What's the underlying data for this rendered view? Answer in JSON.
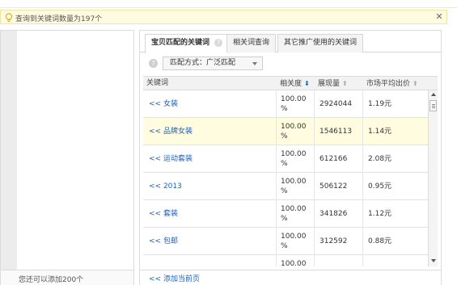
{
  "notice": {
    "message": "查询到关键词数量为197个",
    "close": "✕"
  },
  "left_panel": {
    "remaining_text": "您还可以添加200个"
  },
  "tabs": [
    {
      "label": "宝贝匹配的关键词",
      "active": true,
      "help": "?"
    },
    {
      "label": "相关词查询",
      "active": false
    },
    {
      "label": "其它推广使用的关键词",
      "active": false
    }
  ],
  "match": {
    "help": "?",
    "select_value": "匹配方式：广泛匹配"
  },
  "table": {
    "columns": [
      {
        "label": "关键词",
        "sort": ""
      },
      {
        "label": "相关度",
        "sort": "⬇"
      },
      {
        "label": "展现量",
        "sort": "⬆"
      },
      {
        "label": "市场平均出价",
        "sort": "⬆"
      }
    ],
    "rows": [
      {
        "keyword": "<< 女装",
        "relevance": "100.00 %",
        "impressions": "2924044",
        "price": "1.19元",
        "highlight": false
      },
      {
        "keyword": "<< 品牌女装",
        "relevance": "100.00 %",
        "impressions": "1546113",
        "price": "1.14元",
        "highlight": true
      },
      {
        "keyword": "<< 运动套装",
        "relevance": "100.00 %",
        "impressions": "612166",
        "price": "2.08元",
        "highlight": false
      },
      {
        "keyword": "<< 2013",
        "relevance": "100.00 %",
        "impressions": "506122",
        "price": "0.95元",
        "highlight": false
      },
      {
        "keyword": "<< 套装",
        "relevance": "100.00 %",
        "impressions": "341826",
        "price": "1.12元",
        "highlight": false
      },
      {
        "keyword": "<< 包邮",
        "relevance": "100.00 %",
        "impressions": "312592",
        "price": "0.88元",
        "highlight": false
      },
      {
        "keyword": "",
        "relevance": "100.00",
        "impressions": "",
        "price": "",
        "highlight": false
      }
    ]
  },
  "footer": {
    "add_page": "<< 添加当前页"
  },
  "colors": {
    "notice_bg": "#fffbe0",
    "link": "#1f5fb4",
    "highlight_row": "#fffce0"
  }
}
